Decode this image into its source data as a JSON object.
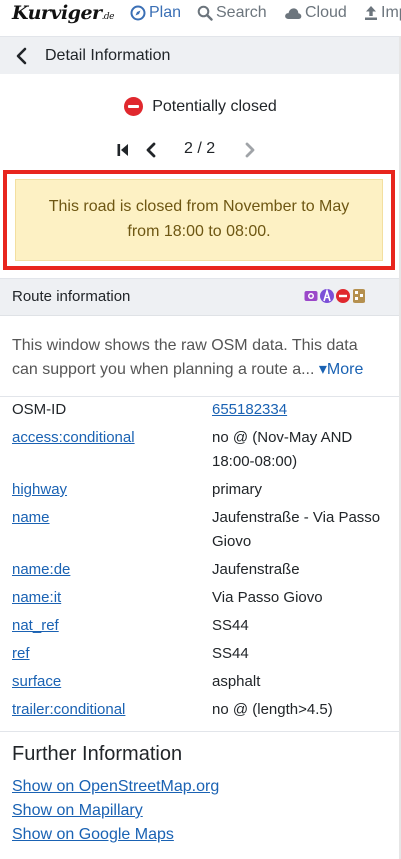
{
  "nav": {
    "logo_main": "Kurviger",
    "logo_suffix": ".de",
    "items": [
      {
        "label": "Plan",
        "icon": "compass-icon"
      },
      {
        "label": "Search",
        "icon": "search-icon"
      },
      {
        "label": "Cloud",
        "icon": "cloud-icon"
      },
      {
        "label": "Imp",
        "icon": "upload-icon"
      }
    ]
  },
  "header": {
    "title": "Detail Information"
  },
  "status": {
    "text": "Potentially closed"
  },
  "pager": {
    "text": "2 / 2"
  },
  "alert": {
    "line1": "This road is closed from November to May",
    "line2": "from 18:00 to 08:00."
  },
  "route": {
    "title": "Route information",
    "icons": [
      "toll-icon",
      "road-type-icon",
      "closed-icon",
      "surface-icon"
    ],
    "colors": {
      "toll": "#9b47c9",
      "road": "#7b4fd8",
      "closed": "#e0282e",
      "surface": "#b5904f"
    }
  },
  "description": {
    "text": "This window shows the raw OSM data. This data can support you when planning a route a...",
    "more_label": "More"
  },
  "tags": [
    {
      "key": "OSM-ID",
      "value": "655182334",
      "key_link": false,
      "value_link": true
    },
    {
      "key": "access:conditional",
      "value": "no @ (Nov-May AND 18:00-08:00)",
      "key_link": true,
      "value_link": false
    },
    {
      "key": "highway",
      "value": "primary",
      "key_link": true,
      "value_link": false
    },
    {
      "key": "name",
      "value": "Jaufenstraße - Via Passo Giovo",
      "key_link": true,
      "value_link": false
    },
    {
      "key": "name:de",
      "value": "Jaufenstraße",
      "key_link": true,
      "value_link": false
    },
    {
      "key": "name:it",
      "value": "Via Passo Giovo",
      "key_link": true,
      "value_link": false
    },
    {
      "key": "nat_ref",
      "value": "SS44",
      "key_link": true,
      "value_link": false
    },
    {
      "key": "ref",
      "value": "SS44",
      "key_link": true,
      "value_link": false
    },
    {
      "key": "surface",
      "value": "asphalt",
      "key_link": true,
      "value_link": false
    },
    {
      "key": "trailer:conditional",
      "value": "no @ (length>4.5)",
      "key_link": true,
      "value_link": false
    }
  ],
  "further": {
    "title": "Further Information",
    "links": [
      "Show on OpenStreetMap.org",
      "Show on Mapillary",
      "Show on Google Maps"
    ]
  },
  "colors": {
    "link": "#1a62b3",
    "alert_bg": "#fdf1c4",
    "alert_text": "#6e5713",
    "highlight_frame": "#e8251d",
    "nav_active": "#3a6fb5"
  }
}
